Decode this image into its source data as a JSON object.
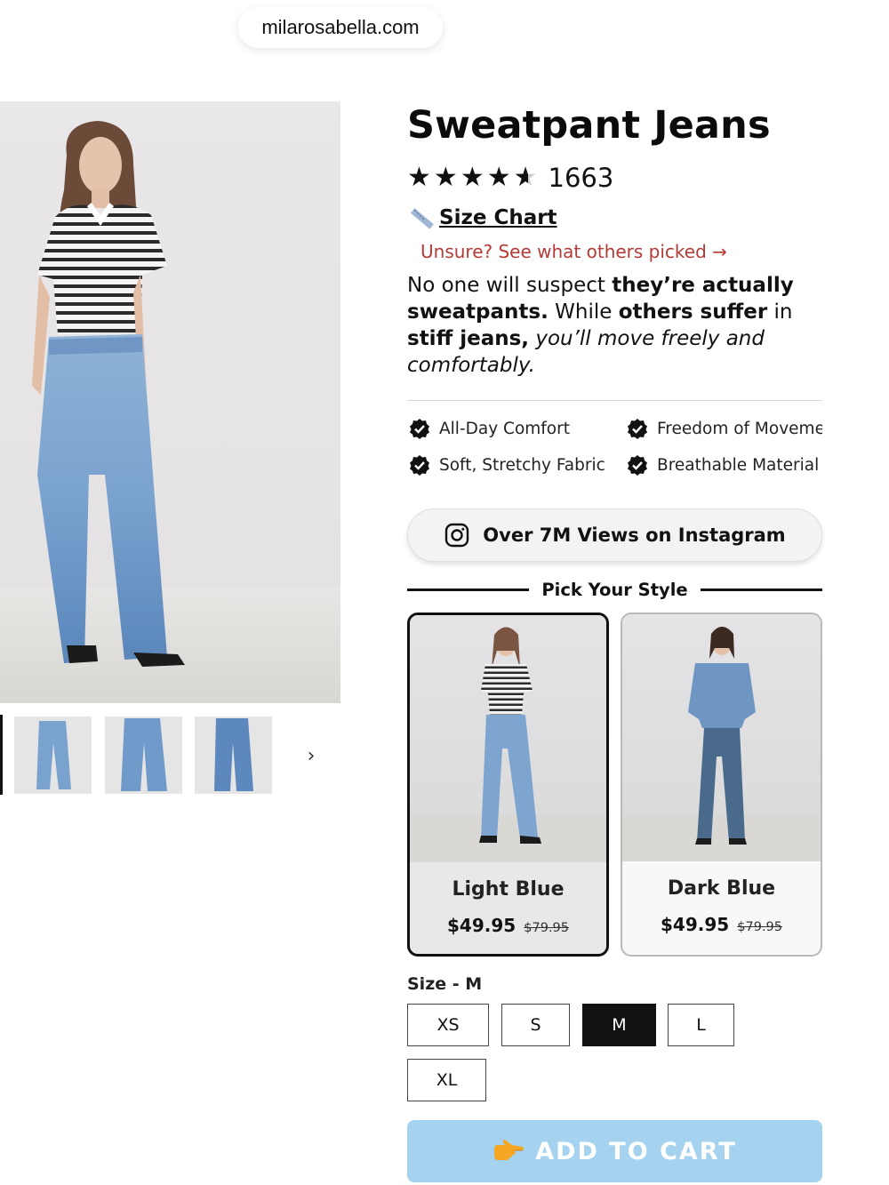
{
  "browser": {
    "url": "milarosabella.com"
  },
  "gallery": {
    "next_icon": "chevron-right-icon",
    "thumbnail_count": 4,
    "active_thumbnail": 1
  },
  "product": {
    "title": "Sweatpant Jeans",
    "rating": 4.5,
    "rating_max": 5,
    "review_count": "1663",
    "size_chart_label": "Size Chart",
    "unsure_link": "Unsure? See what others picked →",
    "description": {
      "p1": "No one will suspect ",
      "b1": "they’re actually sweatpants.",
      "p2": " While ",
      "b2": "others suffer",
      "p3": " in ",
      "b3": "stiff jeans,",
      "i1": " you’ll move freely and comfortably."
    }
  },
  "features": [
    {
      "label": "All-Day Comfort",
      "icon": "check-badge-icon"
    },
    {
      "label": "Freedom of Movement",
      "icon": "check-badge-icon"
    },
    {
      "label": "Soft, Stretchy Fabric",
      "icon": "check-badge-icon"
    },
    {
      "label": "Breathable Material",
      "icon": "check-badge-icon"
    }
  ],
  "instagram_button": {
    "label": "Over 7M Views on Instagram",
    "icon": "instagram-icon"
  },
  "style_picker": {
    "heading": "Pick Your Style",
    "options": [
      {
        "name": "Light Blue",
        "price": "$49.95",
        "compare_price": "$79.95",
        "selected": true
      },
      {
        "name": "Dark Blue",
        "price": "$49.95",
        "compare_price": "$79.95",
        "selected": false
      }
    ]
  },
  "size": {
    "label": "Size - M",
    "options": [
      "XS",
      "S",
      "M",
      "L",
      "XL"
    ],
    "selected": "M"
  },
  "cart": {
    "label": "ADD TO CART",
    "icon": "pointing-hand-icon"
  },
  "colors": {
    "accent_red": "#b43a37",
    "cart_button": "#a5d3ef",
    "selected_size_bg": "#111111"
  }
}
